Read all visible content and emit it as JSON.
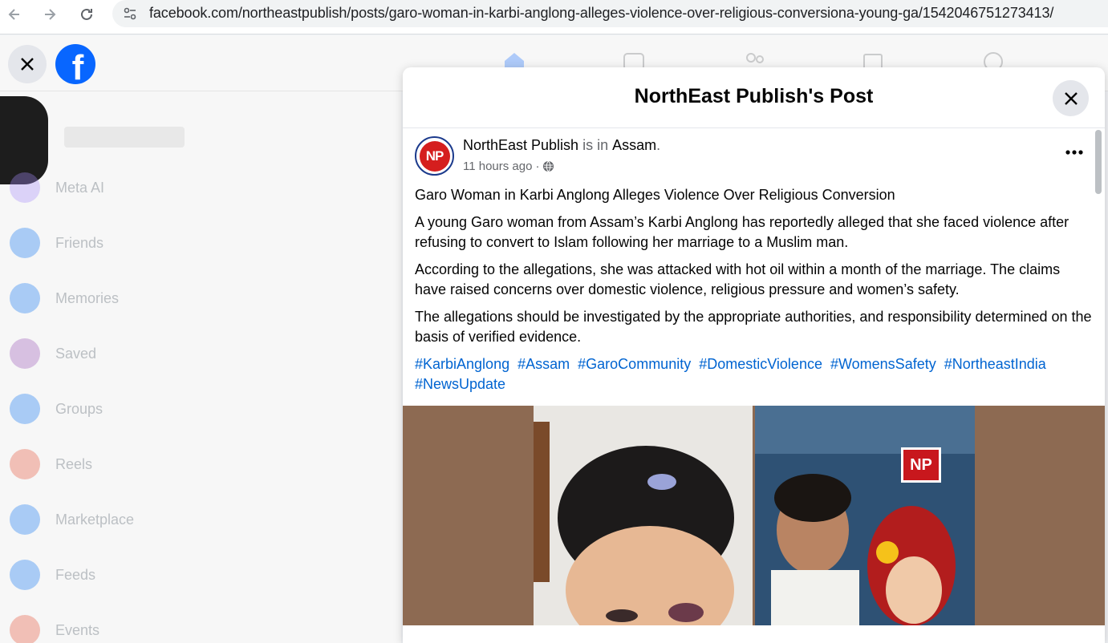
{
  "browser": {
    "url": "facebook.com/northeastpublish/posts/garo-woman-in-karbi-anglong-alleges-violence-over-religious-conversiona-young-ga/1542046751273413/"
  },
  "sidebar": {
    "items": [
      {
        "label": "Meta AI",
        "icon": "meta-ai-icon",
        "color": "#a78bfa"
      },
      {
        "label": "Friends",
        "icon": "friends-icon",
        "color": "#1877f2"
      },
      {
        "label": "Memories",
        "icon": "memories-icon",
        "color": "#1877f2"
      },
      {
        "label": "Saved",
        "icon": "saved-icon",
        "color": "#9b59b6"
      },
      {
        "label": "Groups",
        "icon": "groups-icon",
        "color": "#1877f2"
      },
      {
        "label": "Reels",
        "icon": "reels-icon",
        "color": "#e4573d"
      },
      {
        "label": "Marketplace",
        "icon": "marketplace-icon",
        "color": "#1877f2"
      },
      {
        "label": "Feeds",
        "icon": "feeds-icon",
        "color": "#1877f2"
      },
      {
        "label": "Events",
        "icon": "events-icon",
        "color": "#e4573d"
      }
    ]
  },
  "modal": {
    "title": "NorthEast Publish's Post",
    "post": {
      "author": "NorthEast Publish",
      "is_in": "is in",
      "location": "Assam",
      "period": ".",
      "time": "11 hours ago",
      "separator": "·",
      "paragraphs": [
        "Garo Woman in Karbi Anglong Alleges Violence Over Religious Conversion",
        "A young Garo woman from Assam’s Karbi Anglong has reportedly alleged that she faced violence after refusing to convert to Islam following her marriage to a Muslim man.",
        "According to the allegations, she was attacked with hot oil within a month of the marriage. The claims have raised concerns over domestic violence, religious pressure and women’s safety.",
        "The allegations should be investigated by the appropriate authorities, and responsibility determined on the basis of verified evidence."
      ],
      "hashtags": [
        "#KarbiAnglong",
        "#Assam",
        "#GaroCommunity",
        "#DomesticViolence",
        "#WomensSafety",
        "#NortheastIndia",
        "#NewsUpdate"
      ],
      "avatar_text": "NP",
      "image_badge": "NP"
    }
  },
  "colors": {
    "fb_blue": "#0866ff",
    "link_blue": "#0064d1",
    "brand_red": "#d51e1e"
  }
}
